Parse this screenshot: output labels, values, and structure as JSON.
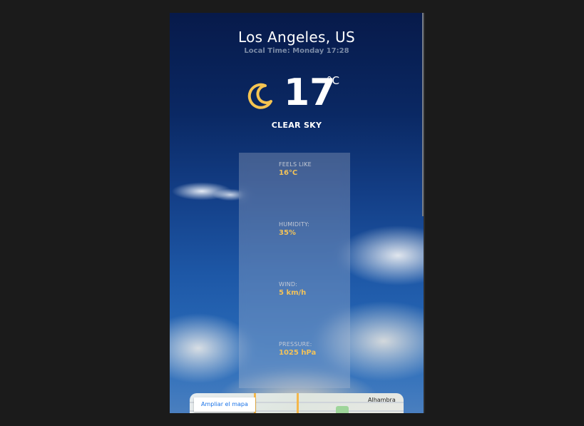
{
  "location": {
    "city": "Los Angeles, US",
    "local_time": "Local Time: Monday 17:28"
  },
  "current": {
    "icon": "crescent-moon-icon",
    "temperature": "17",
    "unit": "°C",
    "description": "CLEAR SKY"
  },
  "stats": [
    {
      "label": "FEELS LIKE",
      "value": "16°C"
    },
    {
      "label": "HUMIDITY:",
      "value": "35%"
    },
    {
      "label": "WIND:",
      "value": "5 km/h"
    },
    {
      "label": "PRESSURE:",
      "value": "1025 hPa"
    }
  ],
  "map": {
    "expand_label": "Ampliar el mapa",
    "place_label": "Alhambra"
  },
  "colors": {
    "accent": "#f2c35a",
    "icon": "#f5c451"
  }
}
